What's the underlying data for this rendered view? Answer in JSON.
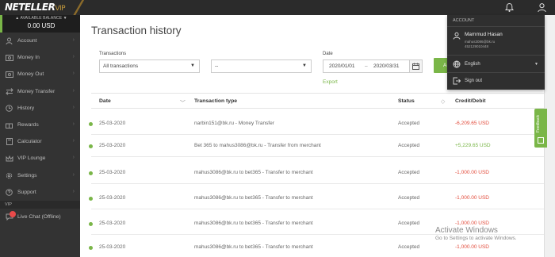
{
  "brand": {
    "name": "NETELLER",
    "tier": "VIP"
  },
  "sidebar": {
    "balance_label": "▲ AVAILABLE BALANCE ▼",
    "balance_value": "0.00 USD",
    "items": [
      {
        "label": "Account",
        "icon": "person-icon"
      },
      {
        "label": "Money In",
        "icon": "money-in-icon"
      },
      {
        "label": "Money Out",
        "icon": "money-out-icon"
      },
      {
        "label": "Money Transfer",
        "icon": "transfer-icon"
      },
      {
        "label": "History",
        "icon": "clock-icon"
      },
      {
        "label": "Rewards",
        "icon": "gift-icon"
      },
      {
        "label": "Calculator",
        "icon": "calculator-icon"
      },
      {
        "label": "VIP Lounge",
        "icon": "crown-icon"
      },
      {
        "label": "Settings",
        "icon": "gear-icon"
      },
      {
        "label": "Support",
        "icon": "help-icon"
      }
    ],
    "vip_section": "VIP",
    "live_chat": "Live Chat (Offline)"
  },
  "main": {
    "title": "Transaction history",
    "transactions_label": "Transactions",
    "transactions_value": "All transactions",
    "second_filter_value": "--",
    "date_label": "Date",
    "date_from": "2020/01/01",
    "date_to": "2020/03/31",
    "apply_partial": "A",
    "export": "Export",
    "columns": [
      "Date",
      "Transaction type",
      "Status",
      "Credit/Debit"
    ],
    "rows": [
      {
        "date": "25-03-2020",
        "type": "narbin151@bk.ru - Money Transfer",
        "status": "Accepted",
        "amount": "-6,209.65 USD",
        "sign": "neg"
      },
      {
        "date": "25-03-2020",
        "type": "Bet 365 to mahus3086@bk.ru - Transfer from merchant",
        "status": "Accepted",
        "amount": "+5,229.65 USD",
        "sign": "pos"
      },
      {
        "date": "25-03-2020",
        "type": "mahus3086@bk.ru to bet365 - Transfer to merchant",
        "status": "Accepted",
        "amount": "-1,000.00 USD",
        "sign": "neg"
      },
      {
        "date": "25-03-2020",
        "type": "mahus3086@bk.ru to bet365 - Transfer to merchant",
        "status": "Accepted",
        "amount": "-1,000.00 USD",
        "sign": "neg"
      },
      {
        "date": "25-03-2020",
        "type": "mahus3086@bk.ru to bet365 - Transfer to merchant",
        "status": "Accepted",
        "amount": "-1,000.00 USD",
        "sign": "neg"
      },
      {
        "date": "25-03-2020",
        "type": "mahus3086@bk.ru to bet365 - Transfer to merchant",
        "status": "Accepted",
        "amount": "-1,000.00 USD",
        "sign": "neg"
      }
    ]
  },
  "account_menu": {
    "header": "ACCOUNT",
    "name": "Mammud Hasan",
    "email": "mahus3086@bk.ru",
    "id": "452129010448",
    "language": "English",
    "sign_out": "Sign out"
  },
  "feedback": "Feedback",
  "watermark": {
    "line1": "Activate Windows",
    "line2": "Go to Settings to activate Windows."
  },
  "colors": {
    "accent": "#7ab648",
    "negative": "#e24b3b",
    "sidebar": "#333333"
  }
}
